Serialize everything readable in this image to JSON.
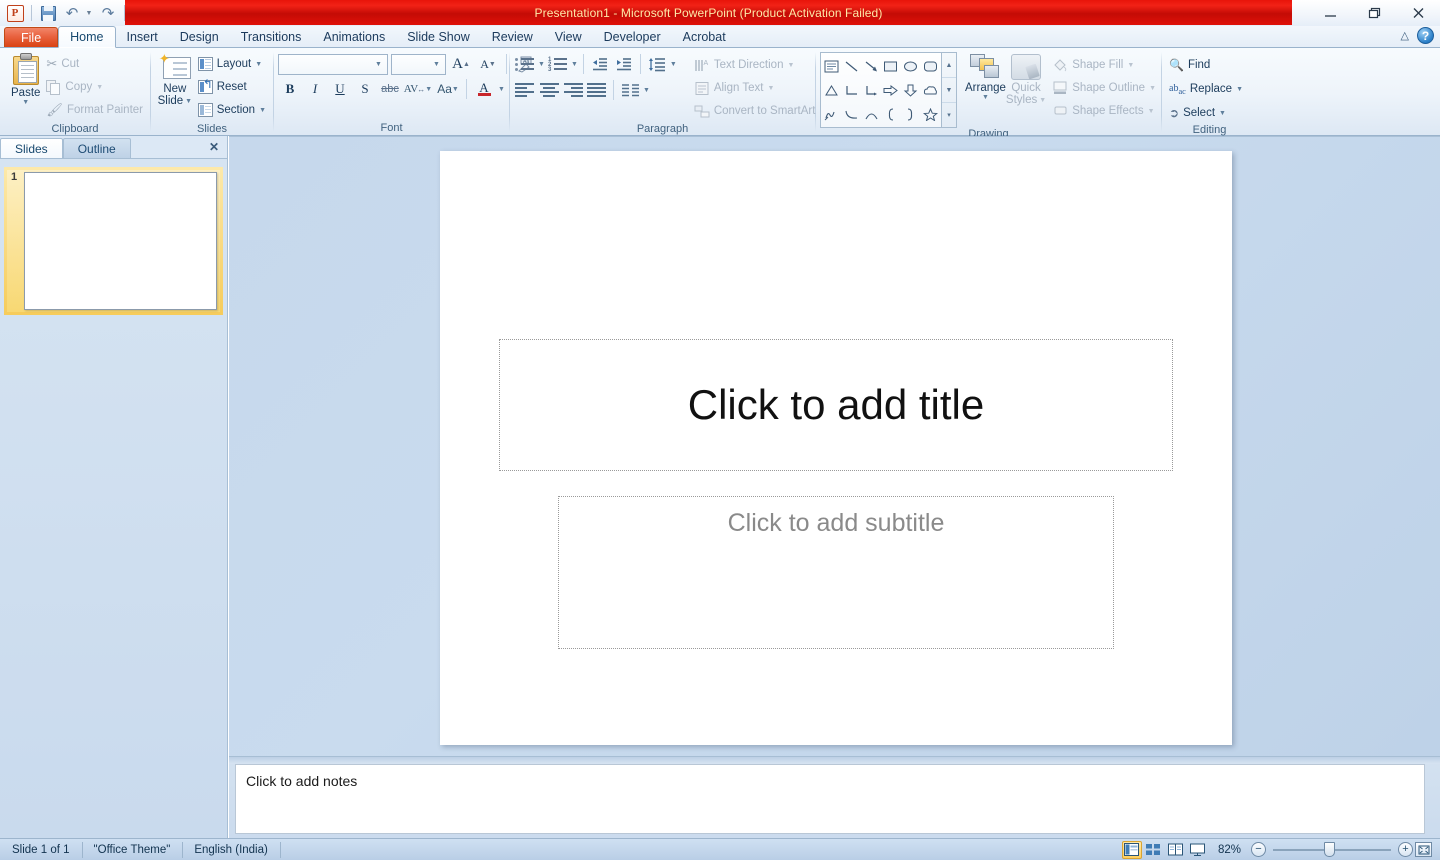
{
  "app": {
    "title": "Presentation1  -  Microsoft PowerPoint (Product Activation Failed)",
    "accent_red": "#e01109",
    "accent_orange": "#d8400f"
  },
  "quick_access": {
    "logo": "P",
    "items": [
      {
        "name": "save-button",
        "icon": "save-icon",
        "label": "Save"
      },
      {
        "name": "undo-button",
        "icon": "undo-icon",
        "label": "Undo"
      },
      {
        "name": "redo-button",
        "icon": "redo-icon",
        "label": "Repeat"
      },
      {
        "name": "customize-qat-button",
        "icon": "chevron-down-icon",
        "label": "Customize Quick Access Toolbar"
      }
    ]
  },
  "window_controls": {
    "minimize": "Minimize",
    "restore": "Restore Down",
    "close": "Close",
    "collapse_ribbon": "Minimize the Ribbon",
    "help": "?"
  },
  "tabs": [
    {
      "label": "File",
      "active": false,
      "file": true
    },
    {
      "label": "Home",
      "active": true
    },
    {
      "label": "Insert",
      "active": false
    },
    {
      "label": "Design",
      "active": false
    },
    {
      "label": "Transitions",
      "active": false
    },
    {
      "label": "Animations",
      "active": false
    },
    {
      "label": "Slide Show",
      "active": false
    },
    {
      "label": "Review",
      "active": false
    },
    {
      "label": "View",
      "active": false
    },
    {
      "label": "Developer",
      "active": false
    },
    {
      "label": "Acrobat",
      "active": false
    }
  ],
  "ribbon": {
    "clipboard": {
      "label": "Clipboard",
      "paste": "Paste",
      "cut": "Cut",
      "copy": "Copy",
      "format_painter": "Format Painter"
    },
    "slides": {
      "label": "Slides",
      "new_slide_line1": "New",
      "new_slide_line2": "Slide",
      "layout": "Layout",
      "reset": "Reset",
      "section": "Section"
    },
    "font": {
      "label": "Font",
      "font_name_value": "",
      "font_name_placeholder": "",
      "font_size_value": "",
      "grow_font": "A",
      "shrink_font": "A",
      "clear_formatting": "Clear All Formatting",
      "bold": "B",
      "italic": "I",
      "underline": "U",
      "shadow": "S",
      "strikethrough": "abc",
      "character_spacing": "AV",
      "change_case": "Aa",
      "font_color": "A"
    },
    "paragraph": {
      "label": "Paragraph",
      "text_direction": "Text Direction",
      "align_text": "Align Text",
      "convert_to_smartart": "Convert to SmartArt"
    },
    "drawing": {
      "label": "Drawing",
      "arrange": "Arrange",
      "quick_styles_line1": "Quick",
      "quick_styles_line2": "Styles",
      "shape_fill": "Shape Fill",
      "shape_outline": "Shape Outline",
      "shape_effects": "Shape Effects",
      "shapes": [
        "text-box-shape",
        "line-shape",
        "arrow-shape",
        "rectangle-shape",
        "oval-shape",
        "rounded-rectangle-shape",
        "triangle-shape",
        "elbow-connector-shape",
        "elbow-arrow-connector-shape",
        "right-arrow-shape",
        "down-arrow-shape",
        "cloud-shape",
        "scribble-shape",
        "curve-shape",
        "arc-shape",
        "left-brace-shape",
        "right-brace-shape",
        "star-shape"
      ]
    },
    "editing": {
      "label": "Editing",
      "find": "Find",
      "replace": "Replace",
      "select": "Select"
    }
  },
  "left_pane": {
    "tabs": [
      {
        "label": "Slides",
        "active": true
      },
      {
        "label": "Outline",
        "active": false
      }
    ],
    "close": "✕",
    "thumbnails": [
      {
        "number": "1",
        "selected": true
      }
    ]
  },
  "slide": {
    "title_placeholder": "Click to add title",
    "subtitle_placeholder": "Click to add subtitle"
  },
  "notes": {
    "placeholder": "Click to add notes"
  },
  "status_bar": {
    "slide_counter": "Slide 1 of 1",
    "theme": "\"Office Theme\"",
    "language": "English (India)",
    "views": [
      {
        "name": "normal-view-button",
        "label": "Normal",
        "selected": true
      },
      {
        "name": "slide-sorter-view-button",
        "label": "Slide Sorter",
        "selected": false
      },
      {
        "name": "reading-view-button",
        "label": "Reading View",
        "selected": false
      },
      {
        "name": "slide-show-button",
        "label": "Slide Show",
        "selected": false
      }
    ],
    "zoom_level": "82%",
    "zoom_out": "−",
    "zoom_in": "+",
    "fit_to_window": "Fit slide to current window"
  }
}
